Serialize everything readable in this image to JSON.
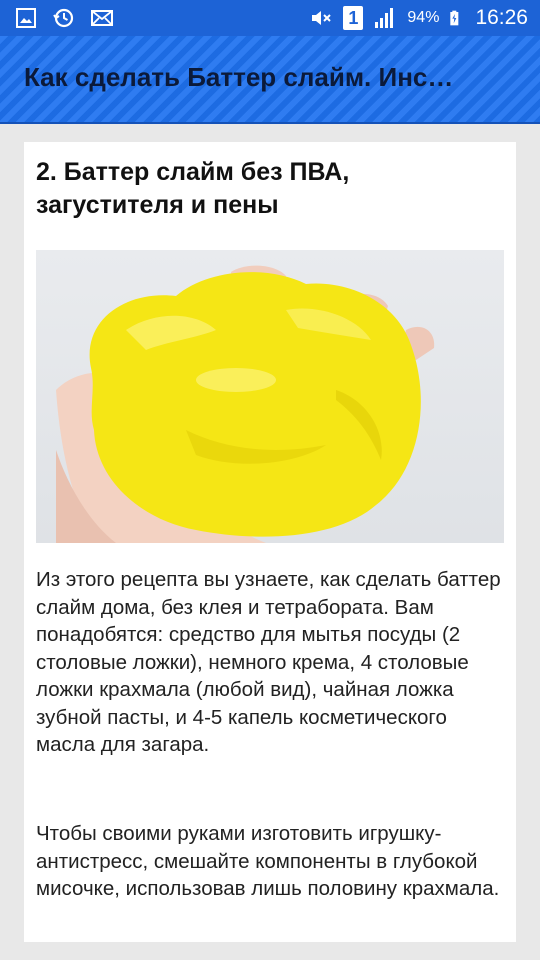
{
  "status_bar": {
    "battery_percent": "94%",
    "sim_slot": "1",
    "time": "16:26",
    "left_icons": [
      "image-icon",
      "sync-icon",
      "mail-icon"
    ],
    "right_icons": [
      "mute-icon",
      "sim-icon",
      "signal-icon",
      "battery-charging-icon"
    ]
  },
  "app_bar": {
    "title": "Как сделать Баттер слайм. Инс…",
    "color": "#1f72f0"
  },
  "article": {
    "heading": "2. Баттер слайм без ПВА, загустителя и пены",
    "image_subject": "yellow-slime-in-hand",
    "paragraphs": [
      "Из этого рецепта вы узнаете, как сделать баттер слайм дома, без клея и тетрабората. Вам понадобятся: средство для мытья посуды (2 столовые ложки), немного крема, 4 столовые ложки крахмала (любой вид), чайная ложка зубной пасты, и 4-5 капель косметического масла для загара.",
      "Чтобы своими руками изготовить игрушку-антистресс, смешайте компоненты в глубокой мисочке, использовав лишь половину крахмала."
    ]
  }
}
